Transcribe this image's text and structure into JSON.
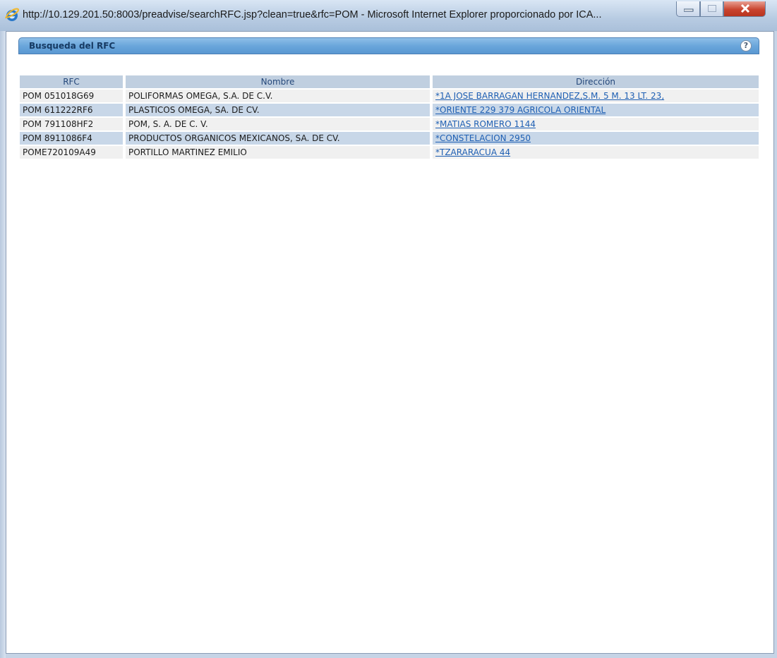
{
  "window": {
    "title": "http://10.129.201.50:8003/preadvise/searchRFC.jsp?clean=true&rfc=POM - Microsoft Internet Explorer proporcionado por ICA...",
    "icon": "internet-explorer-icon"
  },
  "panel": {
    "title": "Busqueda del RFC",
    "help_symbol": "?"
  },
  "table": {
    "headers": [
      "RFC",
      "Nombre",
      "Dirección"
    ],
    "rows": [
      {
        "rfc": "POM 051018G69",
        "nombre": "POLIFORMAS OMEGA, S.A. DE C.V.",
        "direccion": "*1A JOSE BARRAGAN HERNANDEZ,S.M. 5 M. 13 LT. 23,"
      },
      {
        "rfc": "POM 611222RF6",
        "nombre": "PLASTICOS OMEGA, SA. DE CV.",
        "direccion": "*ORIENTE 229 379 AGRICOLA ORIENTAL"
      },
      {
        "rfc": "POM 791108HF2",
        "nombre": "POM, S. A. DE C. V.",
        "direccion": "*MATIAS ROMERO 1144"
      },
      {
        "rfc": "POM 8911086F4",
        "nombre": "PRODUCTOS ORGANICOS MEXICANOS, SA. DE CV.",
        "direccion": "*CONSTELACION 2950"
      },
      {
        "rfc": "POME720109A49",
        "nombre": "PORTILLO MARTINEZ EMILIO",
        "direccion": "*TZARARACUA 44"
      }
    ]
  },
  "colors": {
    "header_bar": "#6aa6db",
    "link": "#1e5fb3",
    "row_alt": "#c8d7e8"
  }
}
